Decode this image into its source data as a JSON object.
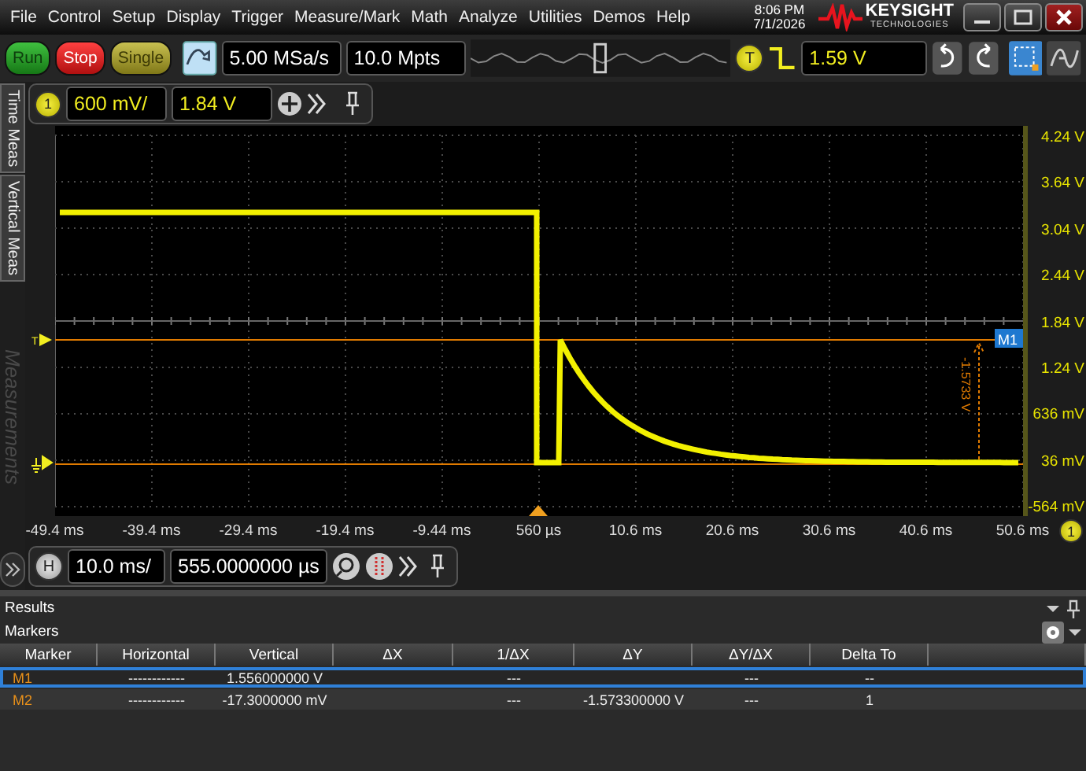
{
  "menu": [
    "File",
    "Control",
    "Setup",
    "Display",
    "Trigger",
    "Measure/Mark",
    "Math",
    "Analyze",
    "Utilities",
    "Demos",
    "Help"
  ],
  "clock": {
    "time": "8:06 PM",
    "date": "7/1/2026"
  },
  "logo": {
    "name": "KEYSIGHT",
    "tagline": "TECHNOLOGIES"
  },
  "acquisition": {
    "buttons": [
      {
        "label": "Run",
        "kind": "run"
      },
      {
        "label": "Stop",
        "kind": "stop"
      },
      {
        "label": "Single",
        "kind": "single"
      }
    ],
    "sample_rate": "5.00 MSa/s",
    "memory_depth": "10.0 Mpts"
  },
  "trigger": {
    "badge": "T",
    "level": "1.59 V"
  },
  "side_tabs": [
    {
      "label": "Time Meas",
      "disabled": false
    },
    {
      "label": "Vertical Meas",
      "disabled": false
    },
    {
      "label": "Measurements",
      "disabled": true
    }
  ],
  "channel": {
    "badge": "1",
    "scale": "600 mV/",
    "offset": "1.84 V"
  },
  "plot": {
    "trigger_marker": "T",
    "marker_label": "M1",
    "delta_label": "-1.5733 V",
    "y_labels": [
      "4.24 V",
      "3.64 V",
      "3.04 V",
      "2.44 V",
      "1.84 V",
      "1.24 V",
      "636 mV",
      "36 mV",
      "-564 mV"
    ],
    "x_labels": [
      "-49.4 ms",
      "-39.4 ms",
      "-29.4 ms",
      "-19.4 ms",
      "-9.44 ms",
      "560 µs",
      "10.6 ms",
      "20.6 ms",
      "30.6 ms",
      "40.6 ms",
      "50.6 ms"
    ],
    "channel_badge": "1"
  },
  "horizontal": {
    "badge": "H",
    "scale": "10.0 ms/",
    "position": "555.0000000 µs"
  },
  "results": {
    "title": "Results",
    "section": "Markers",
    "columns": [
      "Marker",
      "Horizontal",
      "Vertical",
      "ΔX",
      "1/ΔX",
      "ΔY",
      "ΔY/ΔX",
      "Delta To"
    ],
    "rows": [
      {
        "marker": "M1",
        "horizontal": "------------",
        "vertical": "1.556000000 V",
        "inv_dx": "---",
        "dy_dx": "---",
        "delta_to": "--",
        "selected": true
      },
      {
        "marker": "M2",
        "horizontal": "------------",
        "vertical": "-17.3000000 mV",
        "inv_dx": "---",
        "dy": "-1.573300000 V",
        "dy_dx": "---",
        "delta_to": "1",
        "selected": false
      }
    ]
  }
}
